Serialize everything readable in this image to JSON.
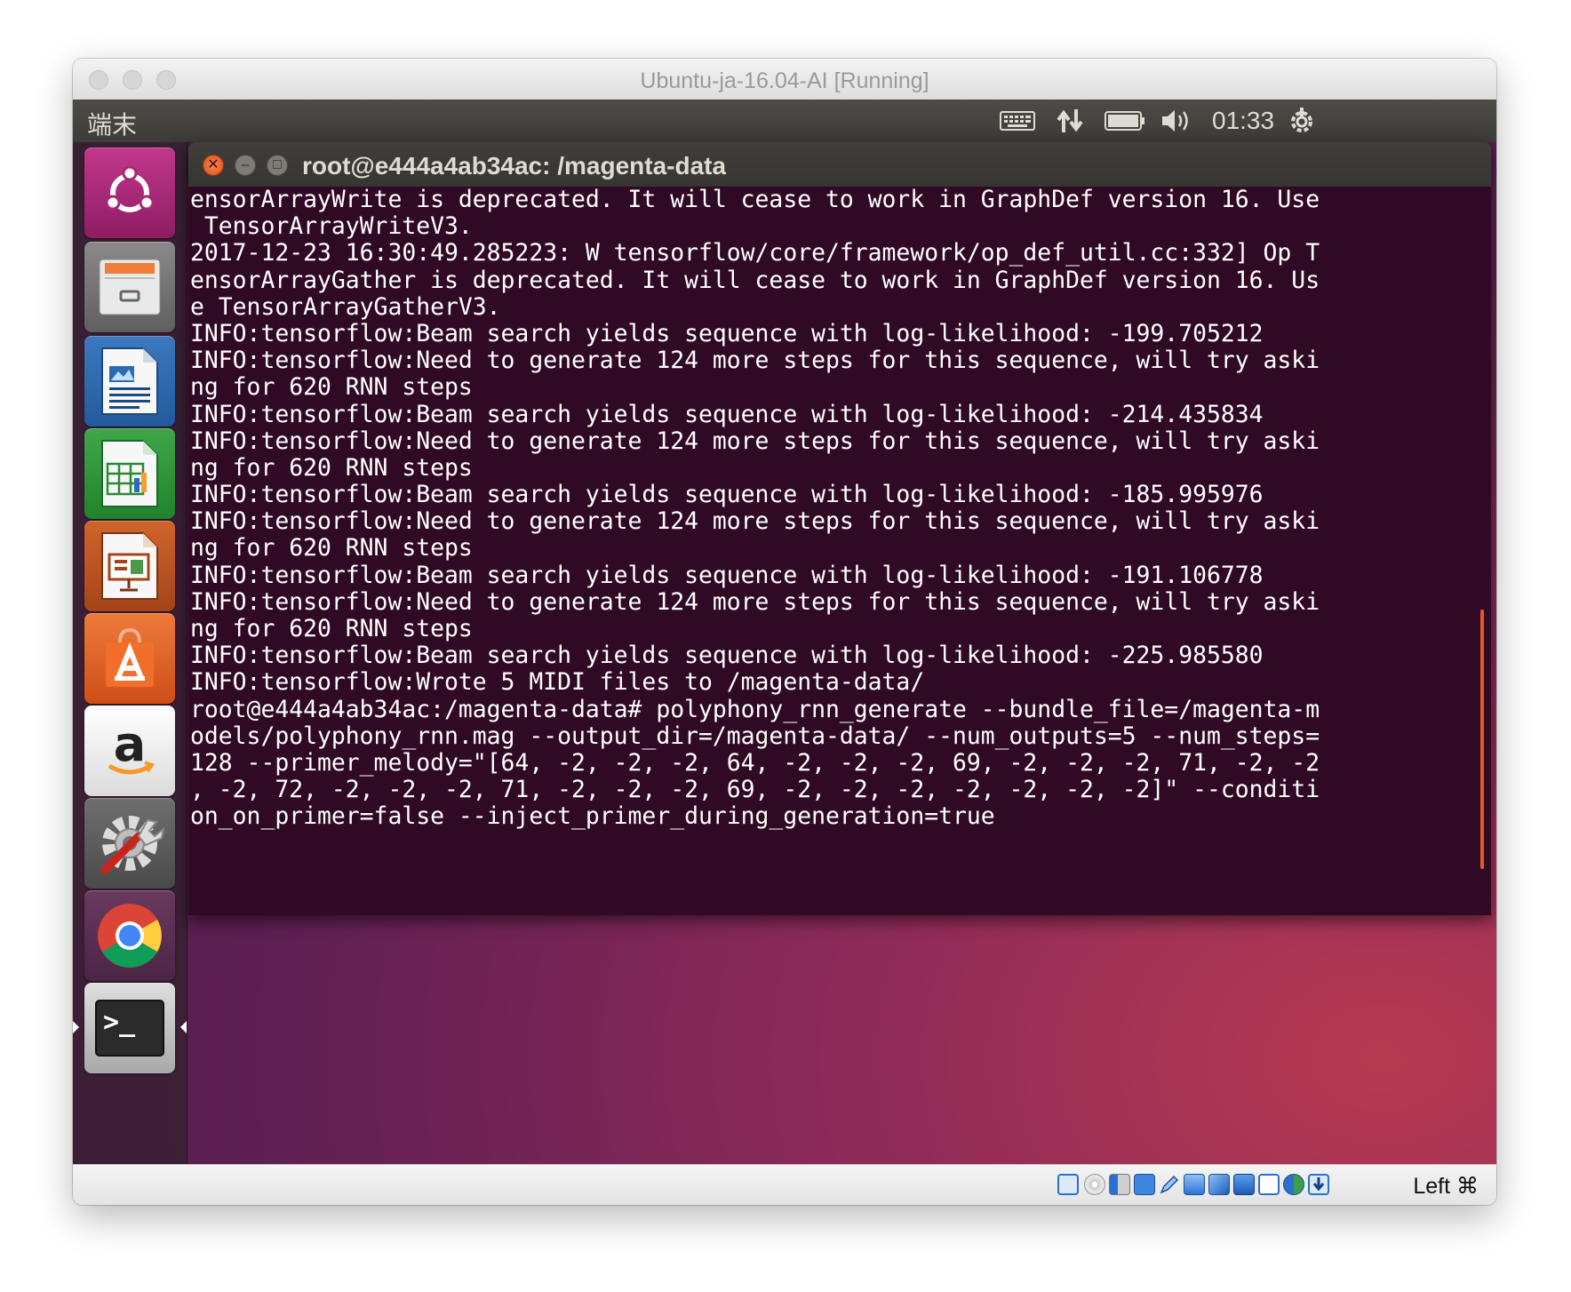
{
  "window": {
    "title": "Ubuntu-ja-16.04-AI [Running]"
  },
  "topbar": {
    "app_name": "端末",
    "clock": "01:33"
  },
  "launcher": {
    "items": [
      {
        "name": "ubuntu-dash-icon"
      },
      {
        "name": "files-icon"
      },
      {
        "name": "writer-icon"
      },
      {
        "name": "calc-icon"
      },
      {
        "name": "impress-icon"
      },
      {
        "name": "software-center-icon"
      },
      {
        "name": "amazon-icon",
        "glyph": "a"
      },
      {
        "name": "system-settings-icon"
      },
      {
        "name": "chrome-icon"
      },
      {
        "name": "terminal-icon",
        "glyph": ">_"
      }
    ]
  },
  "terminal": {
    "title": "root@e444a4ab34ac: /magenta-data",
    "lines": [
      "ensorArrayWrite is deprecated. It will cease to work in GraphDef version 16. Use",
      " TensorArrayWriteV3.",
      "2017-12-23 16:30:49.285223: W tensorflow/core/framework/op_def_util.cc:332] Op T",
      "ensorArrayGather is deprecated. It will cease to work in GraphDef version 16. Us",
      "e TensorArrayGatherV3.",
      "INFO:tensorflow:Beam search yields sequence with log-likelihood: -199.705212",
      "INFO:tensorflow:Need to generate 124 more steps for this sequence, will try aski",
      "ng for 620 RNN steps",
      "INFO:tensorflow:Beam search yields sequence with log-likelihood: -214.435834",
      "INFO:tensorflow:Need to generate 124 more steps for this sequence, will try aski",
      "ng for 620 RNN steps",
      "INFO:tensorflow:Beam search yields sequence with log-likelihood: -185.995976",
      "INFO:tensorflow:Need to generate 124 more steps for this sequence, will try aski",
      "ng for 620 RNN steps",
      "INFO:tensorflow:Beam search yields sequence with log-likelihood: -191.106778",
      "INFO:tensorflow:Need to generate 124 more steps for this sequence, will try aski",
      "ng for 620 RNN steps",
      "INFO:tensorflow:Beam search yields sequence with log-likelihood: -225.985580",
      "INFO:tensorflow:Wrote 5 MIDI files to /magenta-data/",
      "root@e444a4ab34ac:/magenta-data# polyphony_rnn_generate --bundle_file=/magenta-m",
      "odels/polyphony_rnn.mag --output_dir=/magenta-data/ --num_outputs=5 --num_steps=",
      "128 --primer_melody=\"[64, -2, -2, -2, 64, -2, -2, -2, 69, -2, -2, -2, 71, -2, -2",
      ", -2, 72, -2, -2, -2, 71, -2, -2, -2, 69, -2, -2, -2, -2, -2, -2, -2]\" --conditi",
      "on_on_primer=false --inject_primer_during_generation=true"
    ]
  },
  "statusbar": {
    "host_key": "Left ⌘"
  },
  "colors": {
    "terminal_bg": "#300a24",
    "close_button": "#e95420",
    "scrollbar": "#e2572b"
  }
}
